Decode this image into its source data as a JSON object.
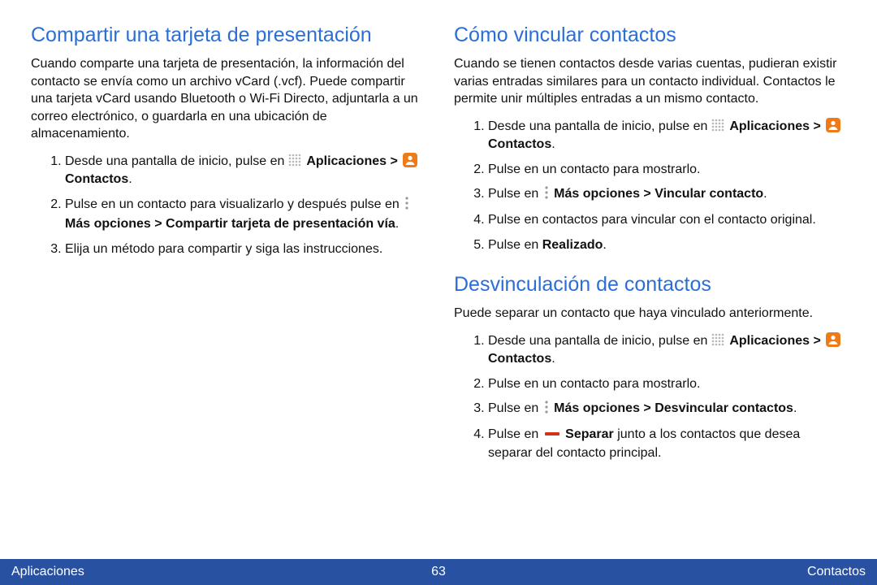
{
  "left": {
    "heading1": "Compartir una tarjeta de presentación",
    "intro1": "Cuando comparte una tarjeta de presentación, la información del contacto se envía como un archivo vCard (.vcf). Puede compartir una tarjeta vCard usando Bluetooth o Wi-Fi Directo, adjuntarla a un correo electrónico, o guardarla en una ubicación de almacenamiento.",
    "step1_pre": "Desde una pantalla de inicio, pulse en ",
    "apps": "Aplicaciones > ",
    "contacts": " Contactos",
    "step2a": "Pulse en un contacto para visualizarlo y después pulse en ",
    "step2b": " Más opciones > Compartir tarjeta de presentación vía",
    "step3": "Elija un método para compartir y siga las instrucciones."
  },
  "right": {
    "heading1": "Cómo vincular contactos",
    "intro1": "Cuando se tienen contactos desde varias cuentas, pudieran existir varias entradas similares para un contacto individual. Contactos le permite unir múltiples entradas a un mismo contacto.",
    "r1_step1_pre": "Desde una pantalla de inicio, pulse en ",
    "r1_step2": "Pulse en un contacto para mostrarlo.",
    "r1_step3a": "Pulse en ",
    "r1_step3b": " Más opciones > Vincular contacto",
    "r1_step4": "Pulse en contactos para vincular con el contacto original.",
    "r1_step5a": "Pulse en ",
    "r1_step5b": "Realizado",
    "heading2": "Desvinculación de contactos",
    "intro2": "Puede separar un contacto que haya vinculado anteriormente.",
    "r2_step1_pre": "Desde una pantalla de inicio, pulse en ",
    "r2_step2": "Pulse en un contacto para mostrarlo.",
    "r2_step3a": "Pulse en ",
    "r2_step3b": " Más opciones > Desvincular contactos",
    "r2_step4a": "Pulse en ",
    "r2_step4b": " Separar",
    "r2_step4c": " junto a los contactos que desea separar del contacto principal."
  },
  "footer": {
    "left": "Aplicaciones",
    "center": "63",
    "right": "Contactos"
  },
  "apps_b": "Aplicaciones > ",
  "contacts_b": " Contactos",
  "period": "."
}
